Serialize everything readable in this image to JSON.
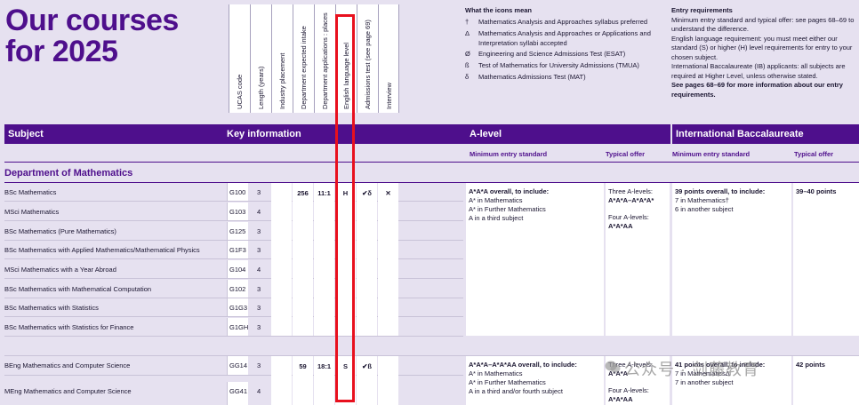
{
  "title_line1": "Our courses",
  "title_line2": "for 2025",
  "columns": [
    "UCAS code",
    "Length (years)",
    "Industry placement",
    "Department expected intake",
    "Department applications : places",
    "English language level",
    "Admissions test (see page 69)",
    "Interview"
  ],
  "legend": {
    "title": "What the icons mean",
    "items": [
      {
        "symbol": "†",
        "text": "Mathematics Analysis and Approaches syllabus preferred"
      },
      {
        "symbol": "Δ",
        "text": "Mathematics Analysis and Approaches or Applications and Interpretation syllabi accepted"
      },
      {
        "symbol": "Ø",
        "text": "Engineering and Science Admissions Test (ESAT)"
      },
      {
        "symbol": "ß",
        "text": "Test of Mathematics for University Admissions (TMUA)"
      },
      {
        "symbol": "δ",
        "text": "Mathematics Admissions Test (MAT)"
      }
    ]
  },
  "entry": {
    "title": "Entry requirements",
    "p1": "Minimum entry standard and typical offer: see pages 68–69 to understand the difference.",
    "p2": "English language requirement: you must meet either our standard (S) or higher (H) level requirements for entry to your chosen subject.",
    "p3": "International Baccalaureate (IB) applicants: all subjects are required at Higher Level, unless otherwise stated.",
    "p4": "See pages 68–69 for more information about our entry requirements."
  },
  "header": {
    "subject": "Subject",
    "key": "Key information",
    "alevel": "A-level",
    "ib": "International Baccalaureate"
  },
  "subheader": {
    "a_min": "Minimum entry standard",
    "a_typ": "Typical offer",
    "ib_min": "Minimum entry standard",
    "ib_typ": "Typical offer"
  },
  "department": "Department of Mathematics",
  "group1": {
    "intake": "256",
    "ratio": "11:1",
    "english": "H",
    "test": "✔δ",
    "interview": "✕",
    "rows": [
      {
        "name": "BSc Mathematics",
        "code": "G100",
        "length": "3"
      },
      {
        "name": "MSci Mathematics",
        "code": "G103",
        "length": "4"
      },
      {
        "name": "BSc Mathematics (Pure Mathematics)",
        "code": "G125",
        "length": "3"
      },
      {
        "name": "BSc Mathematics with Applied Mathematics/Mathematical Physics",
        "code": "G1F3",
        "length": "3"
      },
      {
        "name": "MSci Mathematics with a Year Abroad",
        "code": "G104",
        "length": "4"
      },
      {
        "name": "BSc Mathematics with Mathematical Computation",
        "code": "G102",
        "length": "3"
      },
      {
        "name": "BSc Mathematics with Statistics",
        "code": "G1G3",
        "length": "3"
      },
      {
        "name": "BSc Mathematics with Statistics for Finance",
        "code": "G1GH",
        "length": "3"
      }
    ],
    "a_min": [
      "A*A*A overall, to include:",
      "A* in Mathematics",
      "A* in Further Mathematics",
      "A in a third subject"
    ],
    "a_typ": [
      "Three A-levels:",
      "A*A*A–A*A*A*",
      "Four A-levels:",
      "A*A*AA"
    ],
    "ib_min": [
      "39 points overall, to include:",
      "7 in Mathematics†",
      "6 in another subject"
    ],
    "ib_typ": "39–40 points"
  },
  "group2": {
    "intake": "59",
    "ratio": "18:1",
    "english": "S",
    "test": "✔ß",
    "rows": [
      {
        "name": "BEng Mathematics and Computer Science",
        "code": "GG14",
        "length": "3"
      },
      {
        "name": "MEng Mathematics and Computer Science",
        "code": "GG41",
        "length": "4"
      }
    ],
    "a_min": [
      "A*A*A–A*A*AA overall, to include:",
      "A* in Mathematics",
      "A* in Further Mathematics",
      "A in a third and/or fourth subject"
    ],
    "a_typ": [
      "Three A-levels:",
      "A*A*A",
      "Four A-levels:",
      "A*A*AA"
    ],
    "ib_min": [
      "41 points overall, to include:",
      "7 in MathematicsΔ",
      "7 in another subject"
    ],
    "ib_typ": "42 points"
  },
  "watermark": "公众号 · 剑藤教育"
}
